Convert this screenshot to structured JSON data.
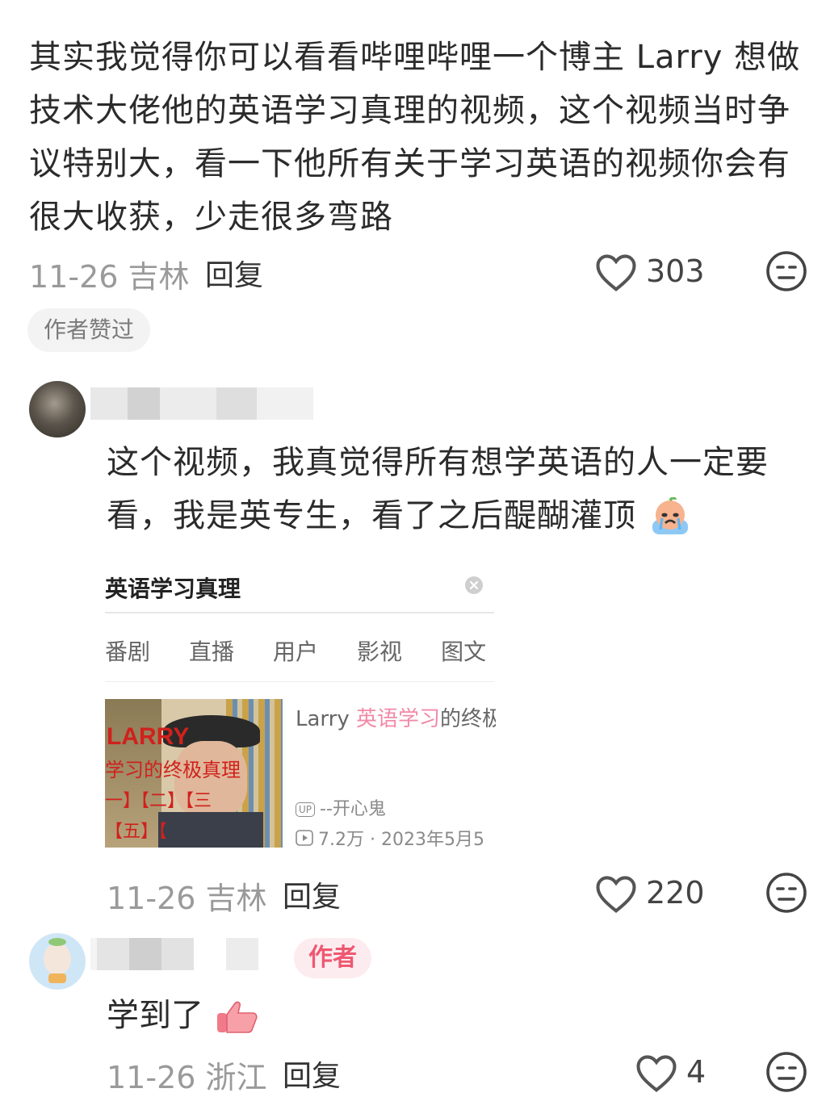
{
  "comment1": {
    "text": "其实我觉得你可以看看哔哩哔哩一个博主 Larry 想做技术大佬他的英语学习真理的视频，这个视频当时争议特别大，看一下他所有关于学习英语的视频你会有很大收获，少走很多弯路",
    "date_location": "11-26 吉林",
    "reply_label": "回复",
    "likes": "303",
    "badge": "作者赞过"
  },
  "comment2": {
    "text": "这个视频，我真觉得所有想学英语的人一定要看，我是英专生，看了之后醍醐灌顶",
    "search_query": "英语学习真理",
    "tabs": [
      "番剧",
      "直播",
      "用户",
      "影视",
      "图文"
    ],
    "video": {
      "title_prefix": "Larry ",
      "title_highlight": "英语学习",
      "title_suffix": "的终极",
      "up_badge": "UP",
      "author": "--开心鬼",
      "stats": "7.2万 · 2023年5月5",
      "thumb_title": "LARRY",
      "thumb_subtitle": "学习的终极真理",
      "thumb_line3": "一】【二】【三",
      "thumb_line4": "【五】【"
    },
    "date_location": "11-26 吉林",
    "reply_label": "回复",
    "likes": "220"
  },
  "comment3": {
    "author_tag": "作者",
    "text": "学到了",
    "date_location": "11-26 浙江",
    "reply_label": "回复",
    "likes": "4"
  },
  "colors": {
    "highlight": "#f28aa8",
    "author_tag": "#ee5872",
    "meta_gray": "#9a9a9a"
  }
}
